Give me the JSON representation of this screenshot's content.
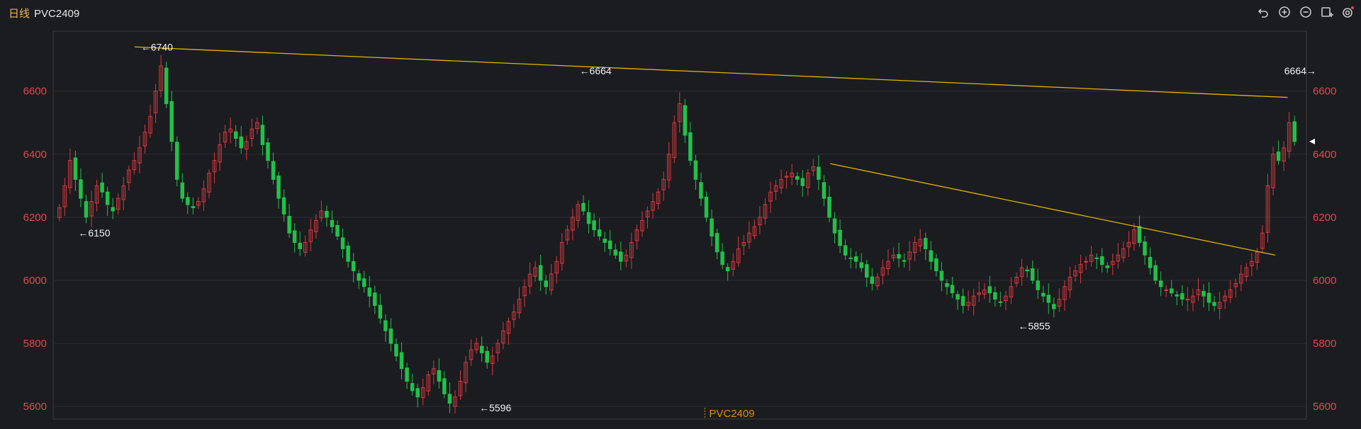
{
  "header": {
    "period": "日线",
    "symbol": "PVC2409"
  },
  "toolbar": {
    "icons": [
      "undo-icon",
      "zoom-in-icon",
      "zoom-out-icon",
      "add-window-icon",
      "settings-icon"
    ]
  },
  "colors": {
    "background": "#1b1c20",
    "up": "#d8393d",
    "down": "#22c04a",
    "grid": "#2c2d33",
    "axis_label": "#e0494c",
    "trendline": "#e0b400",
    "crosshair": "#e08c00"
  },
  "chart_data": {
    "type": "candlestick",
    "symbol_label": "PVC2409",
    "ylim": [
      5560,
      6790
    ],
    "y_ticks": [
      5600,
      5800,
      6000,
      6200,
      6400,
      6600
    ],
    "grid": true,
    "annotations": [
      {
        "text": "←6740",
        "value": 6740
      },
      {
        "text": "←6150",
        "value": 6150
      },
      {
        "text": "←5596",
        "value": 5596
      },
      {
        "text": "←6664",
        "value": 6664
      },
      {
        "text": "←5855",
        "value": 5855
      },
      {
        "text": "6664→",
        "value": 6664
      }
    ],
    "trendlines": [
      {
        "from": [
          6740
        ],
        "to": [
          6580
        ]
      },
      {
        "from": [
          6370
        ],
        "to": [
          6080
        ]
      }
    ],
    "key_points": [
      {
        "label": "start",
        "value": 6220
      },
      {
        "label": "peak",
        "value": 6740
      },
      {
        "label": "trough",
        "value": 5596
      },
      {
        "label": "peak",
        "value": 6664
      },
      {
        "label": "trough",
        "value": 5855
      },
      {
        "label": "last_high",
        "value": 6664
      }
    ],
    "closes": [
      6230,
      6300,
      6380,
      6320,
      6260,
      6200,
      6250,
      6300,
      6280,
      6240,
      6220,
      6260,
      6300,
      6350,
      6380,
      6420,
      6470,
      6520,
      6600,
      6680,
      6560,
      6440,
      6320,
      6260,
      6240,
      6230,
      6250,
      6290,
      6340,
      6380,
      6430,
      6470,
      6480,
      6450,
      6420,
      6440,
      6480,
      6500,
      6430,
      6380,
      6320,
      6260,
      6210,
      6150,
      6120,
      6100,
      6120,
      6160,
      6190,
      6220,
      6200,
      6170,
      6140,
      6100,
      6060,
      6030,
      6000,
      5980,
      5950,
      5920,
      5880,
      5840,
      5800,
      5760,
      5720,
      5680,
      5650,
      5630,
      5660,
      5700,
      5720,
      5680,
      5640,
      5610,
      5630,
      5680,
      5740,
      5780,
      5800,
      5770,
      5740,
      5760,
      5800,
      5840,
      5870,
      5900,
      5940,
      5980,
      6020,
      6040,
      6000,
      5980,
      6020,
      6060,
      6120,
      6160,
      6200,
      6240,
      6220,
      6180,
      6160,
      6140,
      6120,
      6100,
      6080,
      6060,
      6080,
      6120,
      6160,
      6190,
      6220,
      6250,
      6280,
      6320,
      6400,
      6500,
      6560,
      6460,
      6380,
      6320,
      6260,
      6200,
      6140,
      6090,
      6050,
      6030,
      6060,
      6100,
      6120,
      6150,
      6170,
      6200,
      6240,
      6280,
      6300,
      6320,
      6330,
      6340,
      6320,
      6300,
      6340,
      6360,
      6320,
      6260,
      6200,
      6150,
      6110,
      6080,
      6070,
      6060,
      6040,
      6010,
      5990,
      6010,
      6040,
      6060,
      6080,
      6070,
      6060,
      6090,
      6120,
      6130,
      6100,
      6060,
      6030,
      6000,
      5980,
      5960,
      5940,
      5920,
      5930,
      5950,
      5960,
      5970,
      5960,
      5940,
      5930,
      5950,
      5980,
      6010,
      6040,
      6030,
      6000,
      5970,
      5950,
      5930,
      5910,
      5940,
      5980,
      6010,
      6030,
      6050,
      6060,
      6080,
      6070,
      6050,
      6040,
      6060,
      6080,
      6100,
      6120,
      6160,
      6120,
      6080,
      6040,
      6000,
      5980,
      5970,
      5960,
      5950,
      5940,
      5940,
      5950,
      5970,
      5950,
      5930,
      5920,
      5930,
      5950,
      5970,
      5990,
      6020,
      6040,
      6060,
      6090,
      6150,
      6300,
      6400,
      6380,
      6420,
      6500,
      6440
    ]
  }
}
